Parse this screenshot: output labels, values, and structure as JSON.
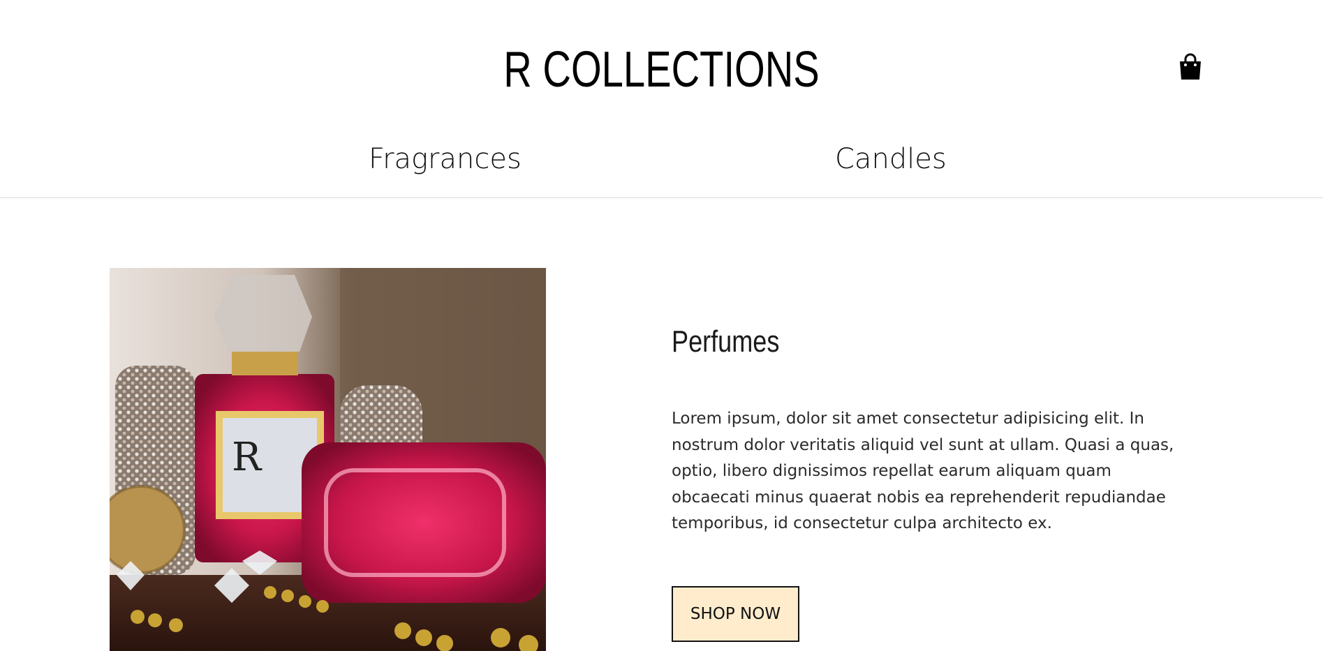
{
  "header": {
    "brand": "R COLLECTIONS",
    "cart_icon": "shopping-bag-icon"
  },
  "nav": {
    "items": [
      {
        "label": "Fragrances"
      },
      {
        "label": "Candles"
      }
    ]
  },
  "product": {
    "title": "Perfumes",
    "description": "Lorem ipsum, dolor sit amet consectetur adipisicing elit. In nostrum dolor veritatis aliquid vel sunt at ullam. Quasi a quas, optio, libero dignissimos repellat earum aliquam quam obcaecati minus quaerat nobis ea reprehenderit repudiandae temporibus, id consectetur culpa architecto ex.",
    "button_label": "SHOP NOW",
    "image_alt": "perfume-photo"
  },
  "colors": {
    "button_bg": "#ffeccc",
    "divider": "#d9d9d9",
    "perfume_pink": "#c8164a"
  }
}
